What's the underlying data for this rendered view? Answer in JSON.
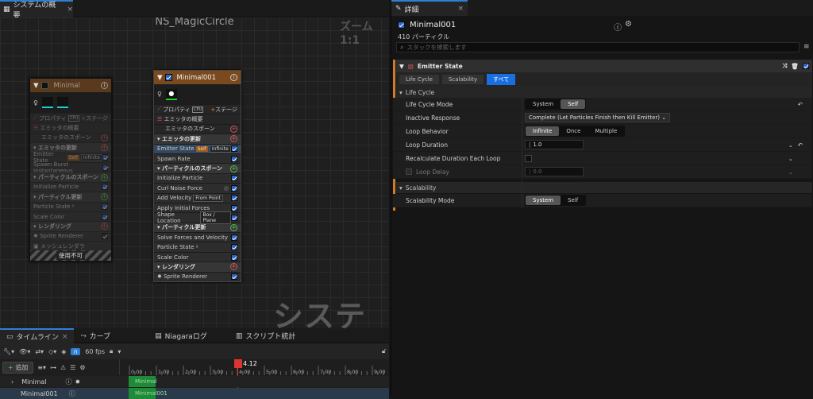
{
  "left_tab": {
    "title": "システムの概要"
  },
  "graph": {
    "title": "NS_MagicCircle",
    "zoom": "ズーム 1:1",
    "watermark": "システム",
    "node_disabled": {
      "name": "Minimal",
      "props": "プロパティ",
      "cpu": "CPU",
      "stage": "ステージ",
      "rows": [
        "エミッタの概要",
        "エミッタのスポーン",
        "エミッタの更新",
        "Emitter State",
        "Spawn Burst Instantaneous",
        "パーティクルのスポーン",
        "Initialize Particle",
        "パーティクル更新",
        "Particle State",
        "Scale Color",
        "レンダリング",
        "Sprite Renderer",
        "メッシュレンダラ"
      ],
      "tag_self": "Self",
      "tag_infinite": "Infinite",
      "footer": "使用不可"
    },
    "node_main": {
      "name": "Minimal001",
      "props": "プロパティ",
      "cpu": "CPU",
      "stage": "ステージ",
      "rows": [
        "エミッタの概要",
        "エミッタのスポーン",
        "エミッタの更新",
        "Emitter State",
        "Spawn Rate",
        "パーティクルのスポーン",
        "Initialize Particle",
        "Curl Noise Force",
        "Add Velocity",
        "Apply Initial Forces",
        "Shape Location",
        "パーティクル更新",
        "Solve Forces and Velocity",
        "Particle State",
        "Scale Color",
        "レンダリング",
        "Sprite Renderer"
      ],
      "tag_self": "Self",
      "tag_infinite": "Infinite",
      "tag_from_point": "From Point",
      "tag_box_plane": "Box / Plane"
    }
  },
  "bottom": {
    "tabs": [
      "タイムライン",
      "カーブ",
      "Niagaraログ",
      "スクリプト統計"
    ],
    "add_label": "追加",
    "fps": "60 fps",
    "time_marker": "4.12",
    "ticks": [
      "0.00",
      "1.00",
      "2.00",
      "3.00",
      "4.00",
      "5.00",
      "6.00",
      "7.00",
      "8.00",
      "9.00"
    ],
    "tracks": [
      "Minimal",
      "Minimal001"
    ]
  },
  "details": {
    "tab": "詳細",
    "emitter_name": "Minimal001",
    "particle_count": "410 パーティクル",
    "search_placeholder": "スタックを検索します",
    "section_title": "Emitter State",
    "filter_tabs": [
      "Life Cycle",
      "Scalability",
      "すべて"
    ],
    "group_lifecycle": "Life Cycle",
    "group_scalability": "Scalability",
    "rows": {
      "life_cycle_mode": {
        "label": "Life Cycle Mode",
        "options": [
          "System",
          "Self"
        ],
        "selected": "Self"
      },
      "inactive_response": {
        "label": "Inactive Response",
        "value": "Complete (Let Particles Finish then Kill Emitter)"
      },
      "loop_behavior": {
        "label": "Loop Behavior",
        "options": [
          "Infinite",
          "Once",
          "Multiple"
        ],
        "selected": "Infinite"
      },
      "loop_duration": {
        "label": "Loop Duration",
        "value": "1.0"
      },
      "recalc_duration": {
        "label": "Recalculate Duration Each Loop"
      },
      "loop_delay": {
        "label": "Loop Delay",
        "value": "0.0"
      },
      "scalability_mode": {
        "label": "Scalability Mode",
        "options": [
          "System",
          "Self"
        ],
        "selected": "System"
      }
    }
  },
  "colors": {
    "accent": "#2f7fd6",
    "emitter_header": "#7a4a1e",
    "checkbox": "#2a64c8"
  }
}
